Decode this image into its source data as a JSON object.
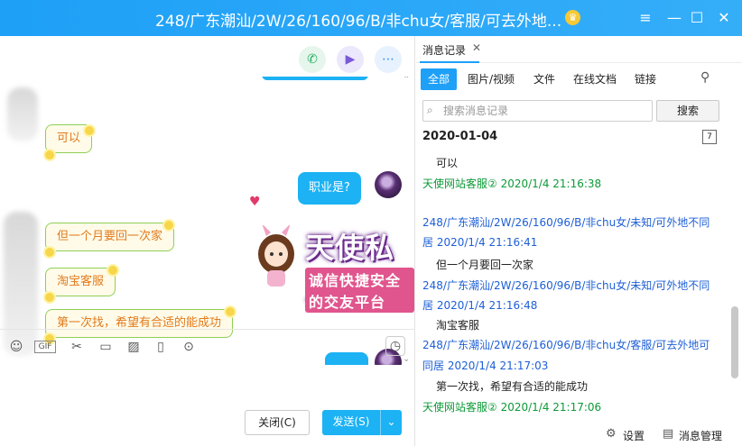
{
  "window": {
    "title": "248/广东潮汕/2W/26/160/96/B/非chu女/客服/可去外地...",
    "badge_icon": "crown-icon"
  },
  "window_controls": {
    "menu": "≡",
    "minimize": "—",
    "maximize": "☐",
    "close": "✕"
  },
  "chat": {
    "messages_left": [
      "可以",
      "但一个月要回一次家",
      "淘宝客服",
      "第一次找，希望有合适的能成功"
    ],
    "messages_right": [
      "职业是?"
    ],
    "watermark_title": "天使私人订制",
    "watermark_sub": "诚信快捷安全的交友平台"
  },
  "composer": {
    "close_label": "关闭(C)",
    "send_label": "发送(S)"
  },
  "history": {
    "tab_title": "消息记录",
    "filters": [
      "全部",
      "图片/视频",
      "文件",
      "在线文档",
      "链接"
    ],
    "search_placeholder": "搜索消息记录",
    "search_button": "搜索",
    "date": "2020-01-04",
    "records": [
      {
        "text": "可以"
      },
      {
        "sender": "天使网站客服② 2020/1/4 21:16:38"
      },
      {
        "sender_wrap1": "248/广东潮汕/2W/26/160/96/B/非chu女/未知/可外地不同",
        "sender_wrap2": "居 2020/1/4 21:16:41"
      },
      {
        "text": "但一个月要回一次家"
      },
      {
        "sender_wrap1": "248/广东潮汕/2W/26/160/96/B/非chu女/未知/可外地不同",
        "sender_wrap2": "居 2020/1/4 21:16:48"
      },
      {
        "text": "淘宝客服"
      },
      {
        "sender_wrap1": "248/广东潮汕/2W/26/160/96/B/非chu女/客服/可去外地可",
        "sender_wrap2": "同居 2020/1/4 21:17:03"
      },
      {
        "text": "第一次找，希望有合适的能成功"
      },
      {
        "sender": "天使网站客服② 2020/1/4 21:17:06"
      }
    ],
    "settings_label": "设置",
    "manage_label": "消息管理"
  },
  "colors": {
    "titlebar": "#1ea0f7",
    "accent": "#1cb2f4",
    "green_sender": "#0c9a37",
    "blue_sender": "#1d5fd6"
  }
}
